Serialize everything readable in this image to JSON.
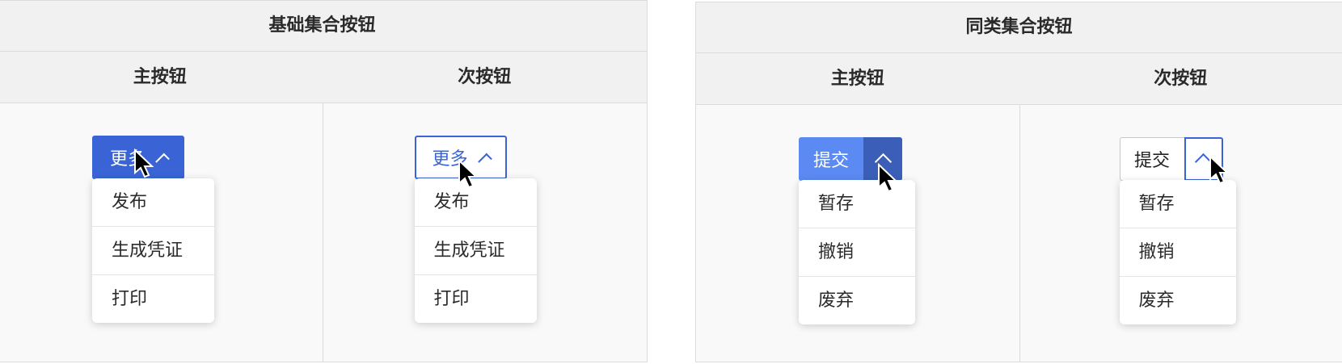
{
  "left_panel": {
    "title": "基础集合按钮",
    "primary": {
      "header": "主按钮",
      "button_label": "更多",
      "menu": [
        "发布",
        "生成凭证",
        "打印"
      ]
    },
    "secondary": {
      "header": "次按钮",
      "button_label": "更多",
      "menu": [
        "发布",
        "生成凭证",
        "打印"
      ]
    }
  },
  "right_panel": {
    "title": "同类集合按钮",
    "primary": {
      "header": "主按钮",
      "button_label": "提交",
      "menu": [
        "暂存",
        "撤销",
        "废弃"
      ]
    },
    "secondary": {
      "header": "次按钮",
      "button_label": "提交",
      "menu": [
        "暂存",
        "撤销",
        "废弃"
      ]
    }
  },
  "icons": {
    "chevron": "chevron-up-icon",
    "cursor": "mouse-pointer-icon"
  },
  "colors": {
    "primary_blue": "#3a64d6",
    "split_primary_main": "#5b8af3",
    "split_primary_toggle": "#3b5fb8",
    "panel_bg": "#f9f9f9",
    "header_bg": "#f1f1f1"
  }
}
